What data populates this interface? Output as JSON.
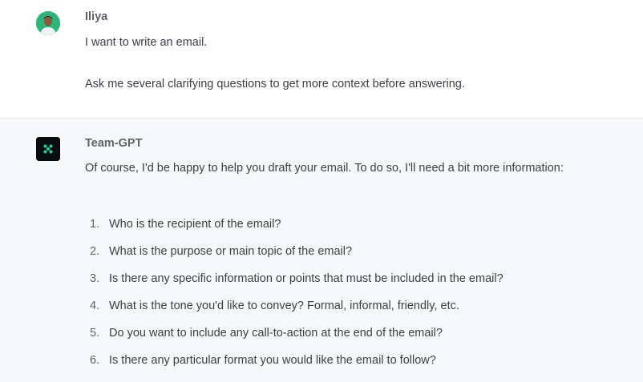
{
  "user_message": {
    "author": "Iliya",
    "paragraphs": [
      "I want to write an email.",
      "Ask me several clarifying questions to get more context before answering."
    ]
  },
  "assistant_message": {
    "author": "Team-GPT",
    "intro": "Of course, I'd be happy to help you draft your email. To do so, I'll need a bit more information:",
    "questions": [
      {
        "num": "1.",
        "text": "Who is the recipient of the email?"
      },
      {
        "num": "2.",
        "text": "What is the purpose or main topic of the email?"
      },
      {
        "num": "3.",
        "text": "Is there any specific information or points that must be included in the email?"
      },
      {
        "num": "4.",
        "text": "What is the tone you'd like to convey? Formal, informal, friendly, etc."
      },
      {
        "num": "5.",
        "text": "Do you want to include any call-to-action at the end of the email?"
      },
      {
        "num": "6.",
        "text": "Is there any particular format you would like the email to follow?"
      }
    ]
  },
  "colors": {
    "assistant_bg": "#f7f8f9",
    "brand_icon_bg": "#0b0c0d",
    "brand_icon_dots": "#1fd49a",
    "user_avatar_bg": "#2fb47c"
  },
  "icons": {
    "user_avatar": "user-avatar-photo",
    "assistant_avatar": "team-gpt-logo-icon"
  }
}
